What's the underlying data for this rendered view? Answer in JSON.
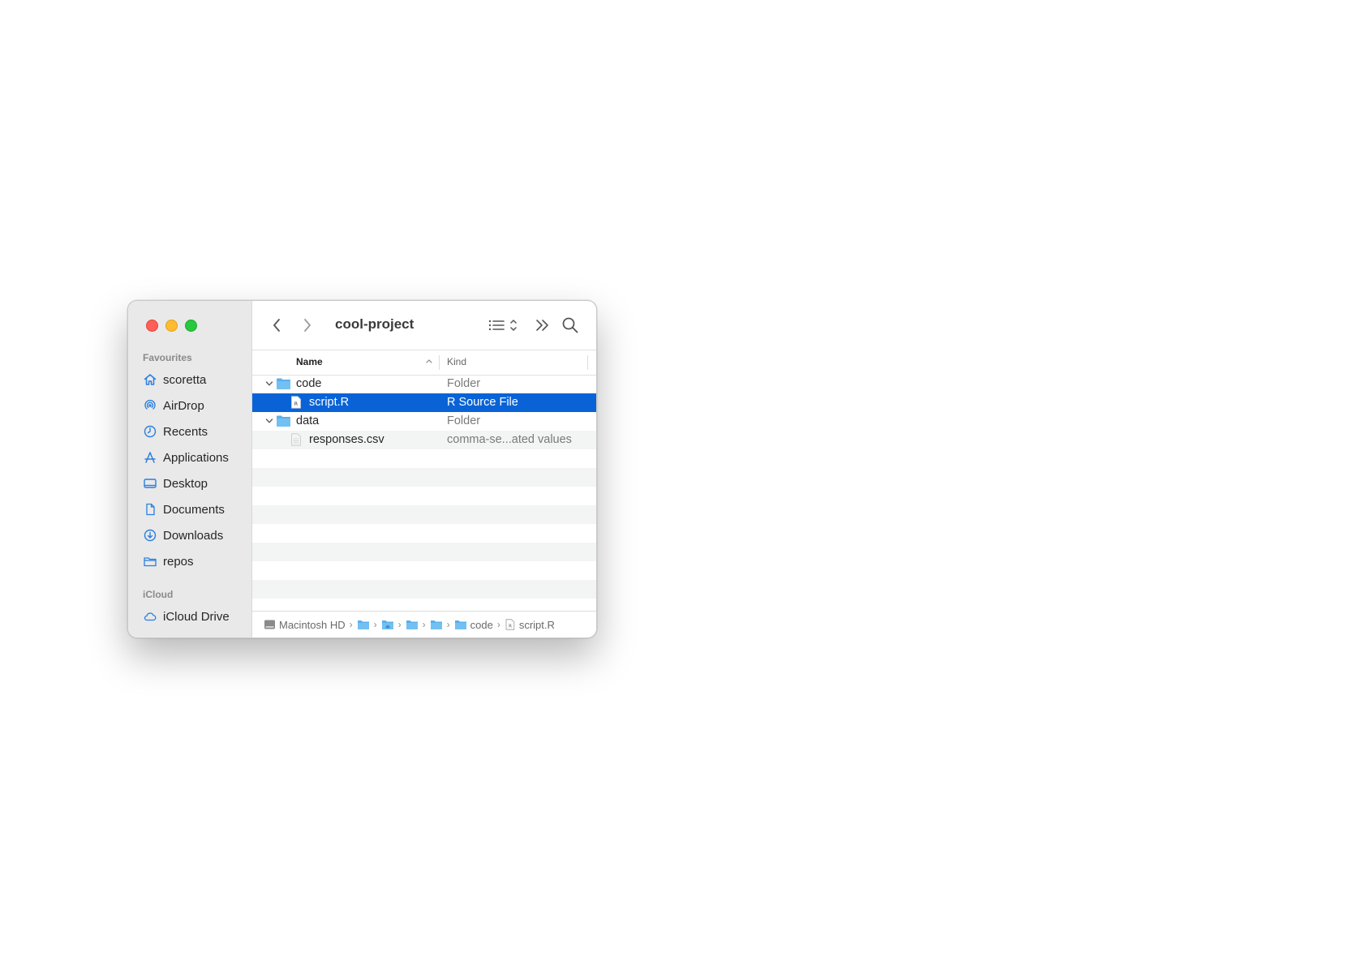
{
  "window": {
    "title": "cool-project"
  },
  "sidebar": {
    "favourites_label": "Favourites",
    "favourites": [
      {
        "label": "scoretta",
        "icon": "house-icon"
      },
      {
        "label": "AirDrop",
        "icon": "airdrop-icon"
      },
      {
        "label": "Recents",
        "icon": "clock-icon"
      },
      {
        "label": "Applications",
        "icon": "applications-icon"
      },
      {
        "label": "Desktop",
        "icon": "desktop-icon"
      },
      {
        "label": "Documents",
        "icon": "document-icon"
      },
      {
        "label": "Downloads",
        "icon": "download-icon"
      },
      {
        "label": "repos",
        "icon": "folder-icon"
      }
    ],
    "icloud_label": "iCloud",
    "icloud": [
      {
        "label": "iCloud Drive",
        "icon": "cloud-icon"
      }
    ]
  },
  "columns": {
    "name": "Name",
    "kind": "Kind"
  },
  "files": [
    {
      "name": "code",
      "kind": "Folder",
      "type": "folder",
      "expanded": true,
      "level": 0
    },
    {
      "name": "script.R",
      "kind": "R Source File",
      "type": "r-file",
      "level": 1,
      "selected": true
    },
    {
      "name": "data",
      "kind": "Folder",
      "type": "folder",
      "expanded": true,
      "level": 0
    },
    {
      "name": "responses.csv",
      "kind": "comma-se...ated values",
      "type": "csv-file",
      "level": 1
    }
  ],
  "pathbar": {
    "disk": "Macintosh HD",
    "folder": "code",
    "file": "script.R"
  },
  "colors": {
    "accent": "#0a63d6",
    "folder": "#5ab0ec",
    "sidebar_icon": "#2a7fe0"
  }
}
